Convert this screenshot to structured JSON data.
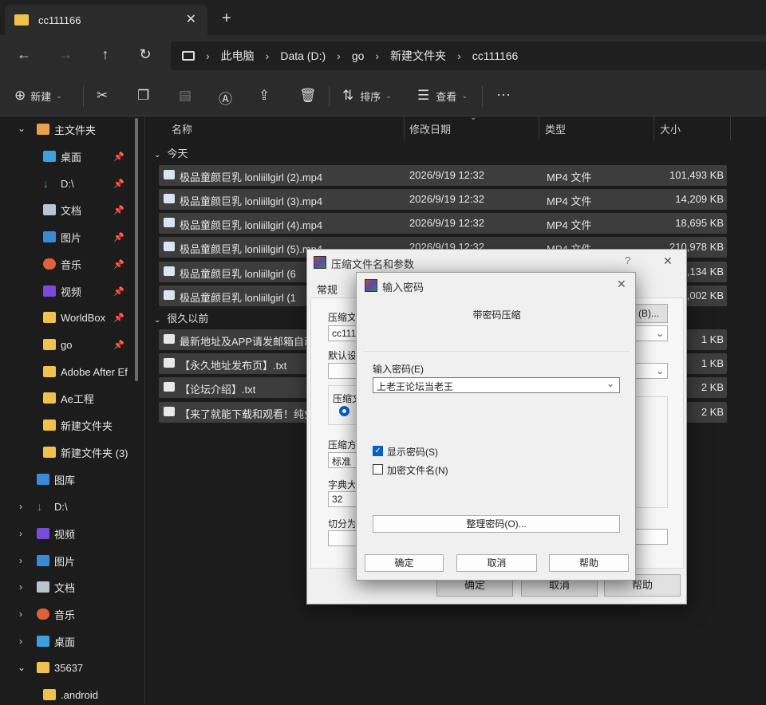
{
  "window": {
    "tab_title": "cc111166",
    "new_tab": "+",
    "tab_close": "✕"
  },
  "nav": {
    "breadcrumbs": [
      "此电脑",
      "Data (D:)",
      "go",
      "新建文件夹",
      "cc111166"
    ]
  },
  "toolbar": {
    "new_label": "新建",
    "sort_label": "排序",
    "view_label": "查看",
    "more": "···"
  },
  "sidebar": {
    "items": [
      {
        "label": "主文件夹",
        "icon": "home-icon"
      },
      {
        "label": "桌面",
        "icon": "desktop-icon",
        "pinned": true
      },
      {
        "label": "D:\\",
        "icon": "download-icon",
        "pinned": true
      },
      {
        "label": "文档",
        "icon": "document-icon",
        "pinned": true
      },
      {
        "label": "图片",
        "icon": "picture-icon",
        "pinned": true
      },
      {
        "label": "音乐",
        "icon": "music-icon",
        "pinned": true
      },
      {
        "label": "视频",
        "icon": "video-icon",
        "pinned": true
      },
      {
        "label": "WorldBox",
        "icon": "folder-icon",
        "pinned": true
      },
      {
        "label": "go",
        "icon": "folder-icon",
        "pinned": true
      },
      {
        "label": "Adobe After Ef",
        "icon": "folder-icon"
      },
      {
        "label": "Ae工程",
        "icon": "folder-icon"
      },
      {
        "label": "新建文件夹",
        "icon": "folder-icon"
      },
      {
        "label": "新建文件夹 (3)",
        "icon": "folder-icon"
      },
      {
        "label": "图库",
        "icon": "gallery-icon"
      },
      {
        "label": "D:\\",
        "icon": "download-icon"
      },
      {
        "label": "视频",
        "icon": "video-icon"
      },
      {
        "label": "图片",
        "icon": "picture-icon"
      },
      {
        "label": "文档",
        "icon": "document-icon"
      },
      {
        "label": "音乐",
        "icon": "music-icon"
      },
      {
        "label": "桌面",
        "icon": "desktop-icon"
      },
      {
        "label": "35637",
        "icon": "folder-icon"
      },
      {
        "label": ".android",
        "icon": "folder-icon"
      }
    ]
  },
  "list": {
    "columns": [
      "名称",
      "修改日期",
      "类型",
      "大小"
    ],
    "groups": [
      "今天",
      "很久以前"
    ],
    "today_files": [
      {
        "name": "极品童颜巨乳 lonliillgirl (2).mp4",
        "date": "2026/9/19 12:32",
        "type": "MP4 文件",
        "size": "101,493 KB"
      },
      {
        "name": "极品童颜巨乳 lonliillgirl (3).mp4",
        "date": "2026/9/19 12:32",
        "type": "MP4 文件",
        "size": "14,209 KB"
      },
      {
        "name": "极品童颜巨乳 lonliillgirl (4).mp4",
        "date": "2026/9/19 12:32",
        "type": "MP4 文件",
        "size": "18,695 KB"
      },
      {
        "name": "极品童颜巨乳 lonliillgirl (5).mp4",
        "date": "2026/9/19 12:32",
        "type": "MP4 文件",
        "size": "210,978 KB"
      },
      {
        "name": "极品童颜巨乳 lonliillgirl (6",
        "date": "",
        "type": "",
        "size": ",134 KB"
      },
      {
        "name": "极品童颜巨乳 lonliillgirl (1",
        "date": "",
        "type": "",
        "size": ",002 KB"
      }
    ],
    "old_files": [
      {
        "name": "最新地址及APP请发邮箱自动",
        "size": "1 KB"
      },
      {
        "name": "【永久地址发布页】.txt",
        "size": "1 KB"
      },
      {
        "name": "【论坛介绍】.txt",
        "size": "2 KB"
      },
      {
        "name": "【来了就能下载和观看！纯免",
        "size": "2 KB"
      }
    ]
  },
  "archive_dialog": {
    "title": "压缩文件名和参数",
    "help_q": "?",
    "close": "✕",
    "tab_general": "常规",
    "label_archive_name": "压缩文",
    "archive_name_value": "cc1111",
    "browse_button": "(B)...",
    "label_default": "默认设",
    "label_format": "压缩文",
    "label_method": "压缩方",
    "method_value": "标准",
    "label_dict": "字典大",
    "dict_value": "32",
    "label_split": "切分为",
    "ok": "确定",
    "cancel": "取消",
    "help": "帮助"
  },
  "password_dialog": {
    "title": "输入密码",
    "close": "✕",
    "heading": "带密码压缩",
    "label_password": "输入密码(E)",
    "password_value": "上老王论坛当老王",
    "show_password": "显示密码(S)",
    "show_password_checked": true,
    "encrypt_names": "加密文件名(N)",
    "encrypt_names_checked": false,
    "organize_button": "整理密码(O)...",
    "ok": "确定",
    "cancel": "取消",
    "help": "帮助"
  }
}
